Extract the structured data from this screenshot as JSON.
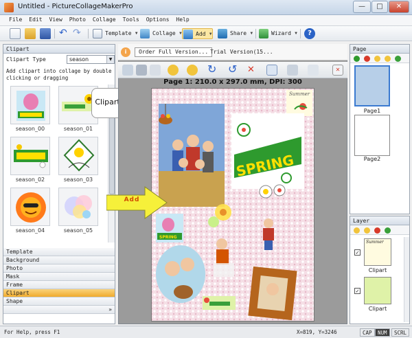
{
  "window": {
    "title": "Untitled - PictureCollageMakerPro"
  },
  "menu": [
    "File",
    "Edit",
    "View",
    "Photo",
    "Collage",
    "Tools",
    "Options",
    "Help"
  ],
  "toolbar": {
    "template_label": "Template",
    "collage_label": "Collage",
    "add_label": "Add",
    "share_label": "Share",
    "wizard_label": "Wizard"
  },
  "clipart_panel": {
    "title": "Clipart",
    "type_label": "Clipart Type",
    "type_value": "season",
    "hint": "Add clipart into collage by double clicking or dragging",
    "items": [
      "season_00",
      "season_01",
      "season_02",
      "season_03",
      "season_04",
      "season_05"
    ]
  },
  "accordion": [
    "Template",
    "Background",
    "Photo",
    "Mask",
    "Frame",
    "Clipart",
    "Shape"
  ],
  "accordion_active": "Clipart",
  "callout": "Clipart pane",
  "arrow_label": "Add",
  "canvas": {
    "order_button": "Order Full Version...",
    "trial_text": "Trial Version(15...",
    "page_info": "Page 1: 210.0 x 297.0 mm, DPI: 300",
    "clip_text": {
      "summer": "Summer",
      "spring": "SPRING",
      "small_spring": "SPRING"
    }
  },
  "page_panel": {
    "title": "Page",
    "pages": [
      "Page1",
      "Page2"
    ]
  },
  "layer_panel": {
    "title": "Layer",
    "items": [
      "Clipart",
      "Clipart"
    ],
    "summer": "Summer"
  },
  "status": {
    "help": "For Help, press F1",
    "coords": "X=819, Y=3246",
    "keys": [
      "CAP",
      "NUM",
      "SCRL"
    ],
    "active_key": "NUM"
  },
  "colors": {
    "accent": "#f0ab2d",
    "spring_green": "#2e9a2e",
    "arrow_yellow": "#f6f03a"
  }
}
